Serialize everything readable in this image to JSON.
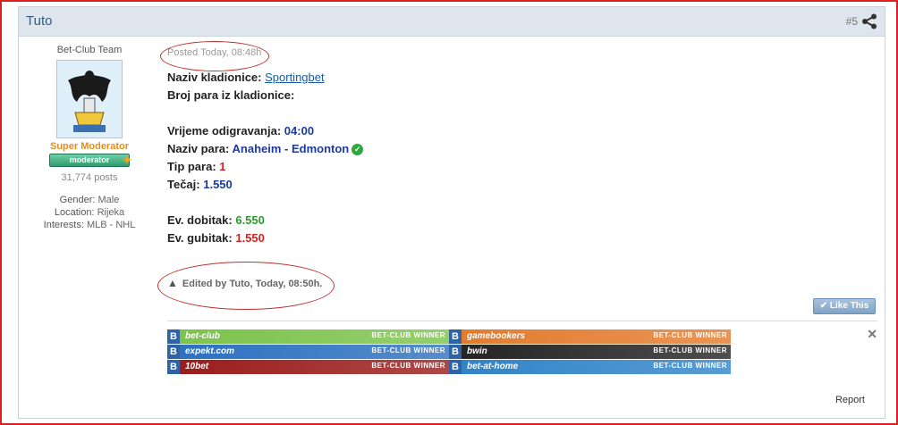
{
  "header": {
    "author": "Tuto",
    "post_number": "#5"
  },
  "user": {
    "usertitle": "Bet-Club Team",
    "rank": "Super Moderator",
    "badge": "moderator",
    "posts": "31,774 posts",
    "gender_label": "Gender:",
    "gender": "Male",
    "location_label": "Location:",
    "location": "Rijeka",
    "interests_label": "Interests:",
    "interests": "MLB - NHL"
  },
  "post": {
    "posted": "Posted Today, 08:48h",
    "bookmaker_label": "Naziv kladionice:",
    "bookmaker": "Sportingbet",
    "pair_count_label": "Broj para iz kladionice:",
    "time_label": "Vrijeme odigravanja:",
    "time": "04:00",
    "pair_label": "Naziv para:",
    "pair": "Anaheim - Edmonton",
    "tip_label": "Tip para:",
    "tip": "1",
    "odds_label": "Tečaj:",
    "odds": "1.550",
    "win_label": "Ev. dobitak:",
    "win": "6.550",
    "loss_label": "Ev. gubitak:",
    "loss": "1.550",
    "edited": "Edited by Tuto, Today, 08:50h."
  },
  "actions": {
    "like": "Like This",
    "report": "Report"
  },
  "banners": [
    {
      "name": "bet-club",
      "tag": "BET-CLUB WINNER",
      "color": "#7bc24a"
    },
    {
      "name": "gamebookers",
      "tag": "BET-CLUB WINNER",
      "color": "#e37a2c"
    },
    {
      "name": "expekt.com",
      "tag": "BET-CLUB WINNER",
      "color": "#2b6fc0"
    },
    {
      "name": "bwin",
      "tag": "BET-CLUB WINNER",
      "color": "#222222"
    },
    {
      "name": "10bet",
      "tag": "BET-CLUB WINNER",
      "color": "#9a1b1b"
    },
    {
      "name": "bet-at-home",
      "tag": "BET-CLUB WINNER",
      "color": "#2f83c8"
    }
  ]
}
